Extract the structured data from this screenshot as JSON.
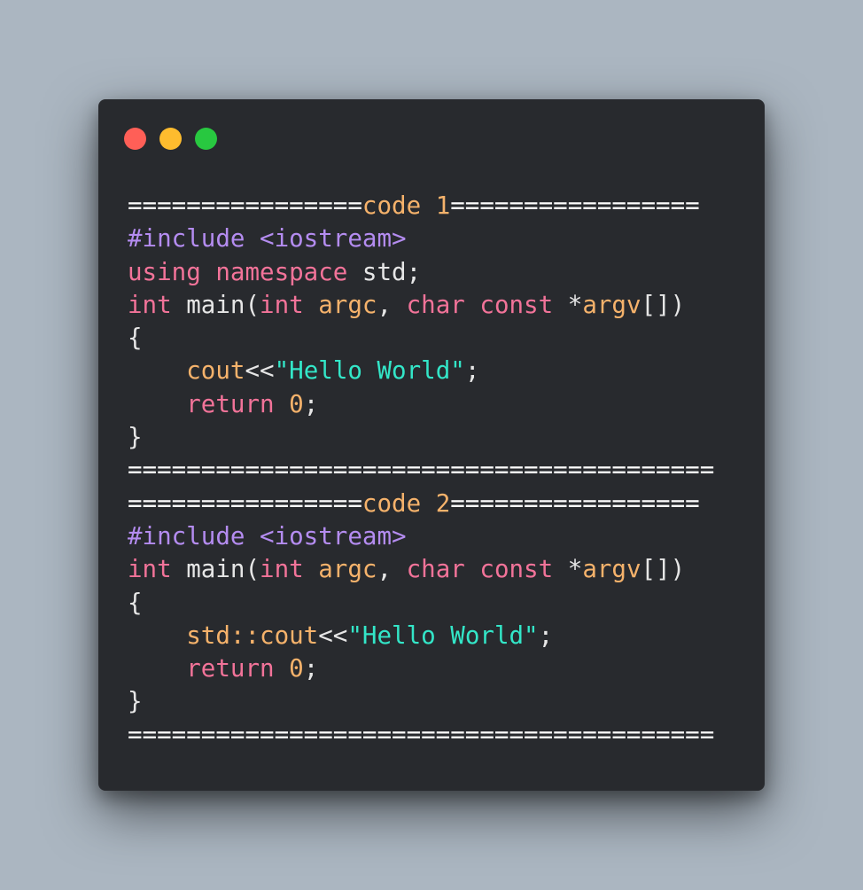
{
  "colors": {
    "background": "#abb6c1",
    "window": "#282a2e",
    "close": "#ff5f57",
    "minimize": "#febc2e",
    "maximize": "#28c840",
    "plain": "#e6e6e6",
    "preprocessor": "#b48cf0",
    "keyword": "#f27399",
    "function": "#f5b26b",
    "string": "#33e6c8",
    "number": "#f5b26b"
  },
  "window_controls": [
    {
      "name": "close-button",
      "color": "#ff5f57"
    },
    {
      "name": "minimize-button",
      "color": "#febc2e"
    },
    {
      "name": "maximize-button",
      "color": "#28c840"
    }
  ],
  "code_lines": [
    [
      {
        "t": "================",
        "c": "sep"
      },
      {
        "t": "code 1",
        "c": "heading"
      },
      {
        "t": "=================",
        "c": "sep"
      }
    ],
    [
      {
        "t": "#include <iostream>",
        "c": "pre"
      }
    ],
    [
      {
        "t": "using namespace",
        "c": "kw"
      },
      {
        "t": " std;",
        "c": "plain"
      }
    ],
    [
      {
        "t": "int",
        "c": "kw"
      },
      {
        "t": " main(",
        "c": "plain"
      },
      {
        "t": "int",
        "c": "kw"
      },
      {
        "t": " ",
        "c": "plain"
      },
      {
        "t": "argc",
        "c": "param"
      },
      {
        "t": ", ",
        "c": "plain"
      },
      {
        "t": "char const",
        "c": "kw"
      },
      {
        "t": " *",
        "c": "plain"
      },
      {
        "t": "argv",
        "c": "param"
      },
      {
        "t": "[])",
        "c": "plain"
      }
    ],
    [
      {
        "t": "{",
        "c": "plain"
      }
    ],
    [
      {
        "t": "    ",
        "c": "plain"
      },
      {
        "t": "cout",
        "c": "fn"
      },
      {
        "t": "<<",
        "c": "plain"
      },
      {
        "t": "\"Hello World\"",
        "c": "str"
      },
      {
        "t": ";",
        "c": "plain"
      }
    ],
    [
      {
        "t": "    ",
        "c": "plain"
      },
      {
        "t": "return",
        "c": "kw"
      },
      {
        "t": " ",
        "c": "plain"
      },
      {
        "t": "0",
        "c": "num"
      },
      {
        "t": ";",
        "c": "plain"
      }
    ],
    [
      {
        "t": "}",
        "c": "plain"
      }
    ],
    [
      {
        "t": "========================================",
        "c": "sep"
      }
    ],
    [
      {
        "t": "================",
        "c": "sep"
      },
      {
        "t": "code 2",
        "c": "heading"
      },
      {
        "t": "=================",
        "c": "sep"
      }
    ],
    [
      {
        "t": "#include <iostream>",
        "c": "pre"
      }
    ],
    [
      {
        "t": "int",
        "c": "kw"
      },
      {
        "t": " main(",
        "c": "plain"
      },
      {
        "t": "int",
        "c": "kw"
      },
      {
        "t": " ",
        "c": "plain"
      },
      {
        "t": "argc",
        "c": "param"
      },
      {
        "t": ", ",
        "c": "plain"
      },
      {
        "t": "char const",
        "c": "kw"
      },
      {
        "t": " *",
        "c": "plain"
      },
      {
        "t": "argv",
        "c": "param"
      },
      {
        "t": "[])",
        "c": "plain"
      }
    ],
    [
      {
        "t": "{",
        "c": "plain"
      }
    ],
    [
      {
        "t": "    ",
        "c": "plain"
      },
      {
        "t": "std::cout",
        "c": "fn"
      },
      {
        "t": "<<",
        "c": "plain"
      },
      {
        "t": "\"Hello World\"",
        "c": "str"
      },
      {
        "t": ";",
        "c": "plain"
      }
    ],
    [
      {
        "t": "    ",
        "c": "plain"
      },
      {
        "t": "return",
        "c": "kw"
      },
      {
        "t": " ",
        "c": "plain"
      },
      {
        "t": "0",
        "c": "num"
      },
      {
        "t": ";",
        "c": "plain"
      }
    ],
    [
      {
        "t": "}",
        "c": "plain"
      }
    ],
    [
      {
        "t": "========================================",
        "c": "sep"
      }
    ]
  ]
}
